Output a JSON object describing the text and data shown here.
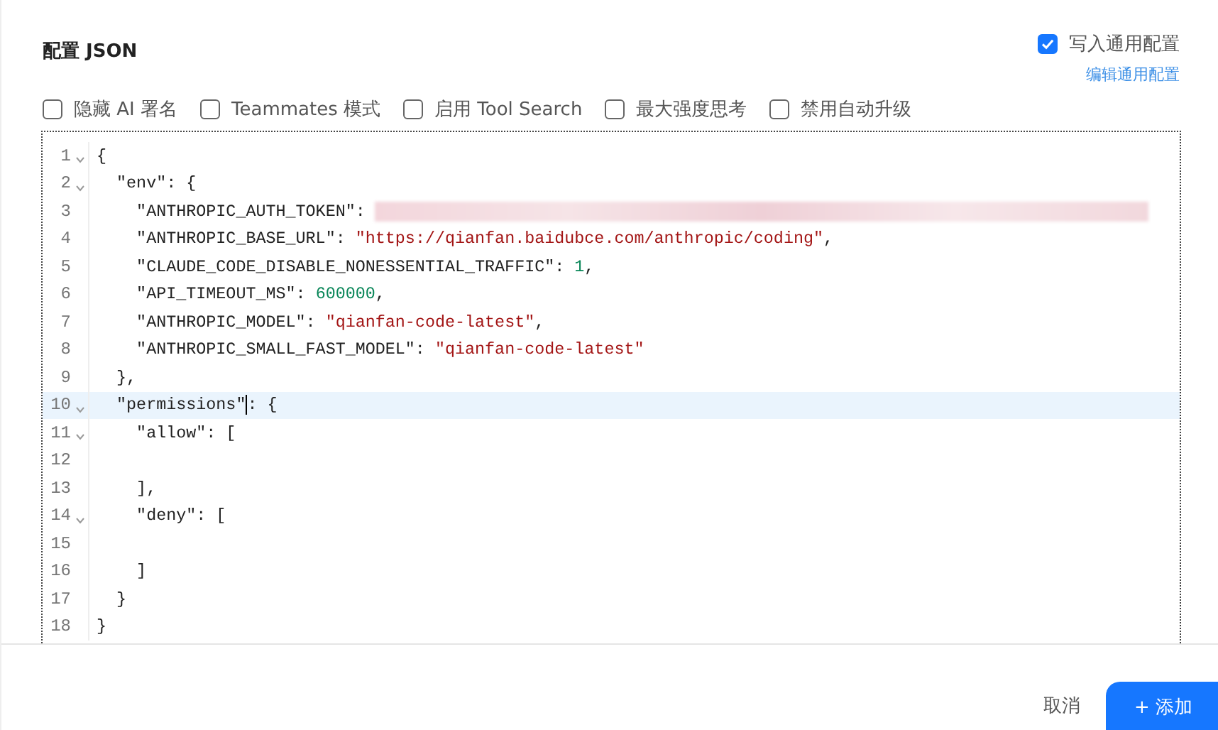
{
  "title": "配置 JSON",
  "write_common": {
    "label": "写入通用配置",
    "checked": true
  },
  "edit_link": "编辑通用配置",
  "options": [
    {
      "label": "隐藏 AI 署名",
      "checked": false
    },
    {
      "label": "Teammates 模式",
      "checked": false
    },
    {
      "label": "启用 Tool Search",
      "checked": false
    },
    {
      "label": "最大强度思考",
      "checked": false
    },
    {
      "label": "禁用自动升级",
      "checked": false
    }
  ],
  "editor": {
    "lines": [
      {
        "num": "1",
        "fold": true,
        "active": false,
        "tokens": [
          {
            "kind": "punct",
            "text": "{"
          }
        ]
      },
      {
        "num": "2",
        "fold": true,
        "active": false,
        "tokens": [
          {
            "kind": "punct",
            "text": "  \"env\": {"
          }
        ]
      },
      {
        "num": "3",
        "fold": false,
        "active": false,
        "tokens": [
          {
            "kind": "punct",
            "text": "    \"ANTHROPIC_AUTH_TOKEN\": "
          },
          {
            "kind": "redacted"
          }
        ]
      },
      {
        "num": "4",
        "fold": false,
        "active": false,
        "tokens": [
          {
            "kind": "punct",
            "text": "    \"ANTHROPIC_BASE_URL\": "
          },
          {
            "kind": "string",
            "text": "\"https://qianfan.baidubce.com/anthropic/coding\""
          },
          {
            "kind": "punct",
            "text": ","
          }
        ]
      },
      {
        "num": "5",
        "fold": false,
        "active": false,
        "tokens": [
          {
            "kind": "punct",
            "text": "    \"CLAUDE_CODE_DISABLE_NONESSENTIAL_TRAFFIC\": "
          },
          {
            "kind": "number",
            "text": "1"
          },
          {
            "kind": "punct",
            "text": ","
          }
        ]
      },
      {
        "num": "6",
        "fold": false,
        "active": false,
        "tokens": [
          {
            "kind": "punct",
            "text": "    \"API_TIMEOUT_MS\": "
          },
          {
            "kind": "number",
            "text": "600000"
          },
          {
            "kind": "punct",
            "text": ","
          }
        ]
      },
      {
        "num": "7",
        "fold": false,
        "active": false,
        "tokens": [
          {
            "kind": "punct",
            "text": "    \"ANTHROPIC_MODEL\": "
          },
          {
            "kind": "string",
            "text": "\"qianfan-code-latest\""
          },
          {
            "kind": "punct",
            "text": ","
          }
        ]
      },
      {
        "num": "8",
        "fold": false,
        "active": false,
        "tokens": [
          {
            "kind": "punct",
            "text": "    \"ANTHROPIC_SMALL_FAST_MODEL\": "
          },
          {
            "kind": "string",
            "text": "\"qianfan-code-latest\""
          }
        ]
      },
      {
        "num": "9",
        "fold": false,
        "active": false,
        "tokens": [
          {
            "kind": "punct",
            "text": "  },"
          }
        ]
      },
      {
        "num": "10",
        "fold": true,
        "active": true,
        "tokens": [
          {
            "kind": "punct",
            "text": "  \"permissions\"",
            "caret_after": true
          },
          {
            "kind": "punct",
            "text": ": {"
          }
        ]
      },
      {
        "num": "11",
        "fold": true,
        "active": false,
        "tokens": [
          {
            "kind": "punct",
            "text": "    \"allow\": ["
          }
        ]
      },
      {
        "num": "12",
        "fold": false,
        "active": false
      },
      {
        "num": "13",
        "fold": false,
        "active": false,
        "tokens": [
          {
            "kind": "punct",
            "text": "    ],"
          }
        ]
      },
      {
        "num": "14",
        "fold": true,
        "active": false,
        "tokens": [
          {
            "kind": "punct",
            "text": "    \"deny\": ["
          }
        ]
      },
      {
        "num": "15",
        "fold": false,
        "active": false
      },
      {
        "num": "16",
        "fold": false,
        "active": false,
        "tokens": [
          {
            "kind": "punct",
            "text": "    ]"
          }
        ]
      },
      {
        "num": "17",
        "fold": false,
        "active": false,
        "tokens": [
          {
            "kind": "punct",
            "text": "  }"
          }
        ]
      },
      {
        "num": "18",
        "fold": false,
        "active": false,
        "tokens": [
          {
            "kind": "punct",
            "text": "}"
          }
        ]
      }
    ]
  },
  "buttons": [
    {
      "label": "取消",
      "kind": "text"
    },
    {
      "label": "+ 添加",
      "kind": "primary"
    }
  ]
}
